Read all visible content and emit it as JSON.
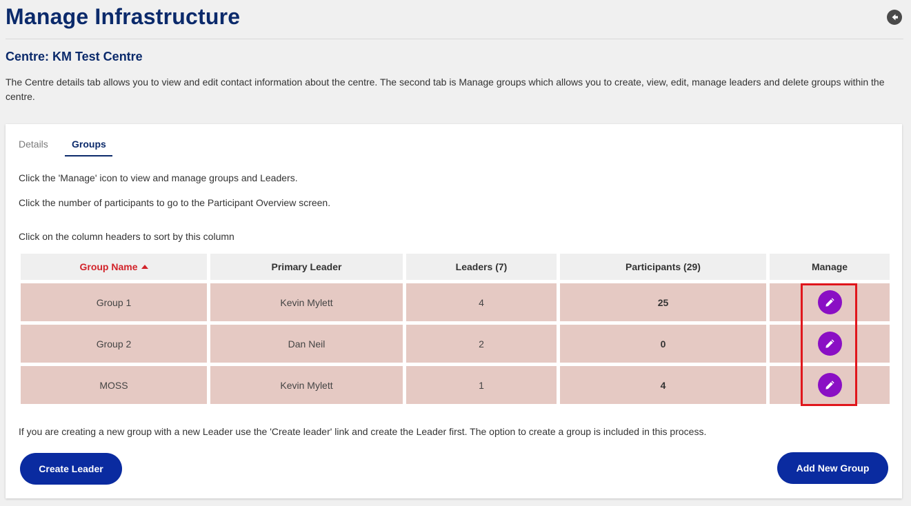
{
  "page": {
    "title": "Manage Infrastructure",
    "back_icon": "arrow-left-circle-icon"
  },
  "centre": {
    "title": "Centre: KM Test Centre",
    "description": "The Centre details tab allows you to view and edit contact information about the centre. The second tab is Manage groups which allows you to create, view, edit, manage leaders and delete groups within the centre."
  },
  "tabs": [
    {
      "label": "Details",
      "active": false
    },
    {
      "label": "Groups",
      "active": true
    }
  ],
  "groups": {
    "instruction_manage": "Click the 'Manage' icon to view and manage groups and Leaders.",
    "instruction_participants": "Click the number of participants to go to the Participant Overview screen.",
    "instruction_sort": "Click on the column headers to sort by this column",
    "columns": {
      "group_name": "Group Name",
      "primary_leader": "Primary Leader",
      "leaders": "Leaders (7)",
      "participants": "Participants (29)",
      "manage": "Manage"
    },
    "sorted_column": "Group Name",
    "rows": [
      {
        "name": "Group 1",
        "primary_leader": "Kevin Mylett",
        "leaders": "4",
        "participants": "25"
      },
      {
        "name": "Group 2",
        "primary_leader": "Dan Neil",
        "leaders": "2",
        "participants": "0"
      },
      {
        "name": "MOSS",
        "primary_leader": "Kevin Mylett",
        "leaders": "1",
        "participants": "4"
      }
    ],
    "note": "If you are creating a new group with a new Leader use the 'Create leader' link and create the Leader first. The option to create a group is included in this process.",
    "create_leader_label": "Create Leader",
    "add_group_label": "Add New Group"
  },
  "colors": {
    "brand_navy": "#0b2a6b",
    "button_blue": "#0a2ba0",
    "edit_purple": "#8a0fc4",
    "row_bg": "#e5c9c3",
    "sort_red": "#d2232a",
    "highlight_red": "#e0161c"
  }
}
